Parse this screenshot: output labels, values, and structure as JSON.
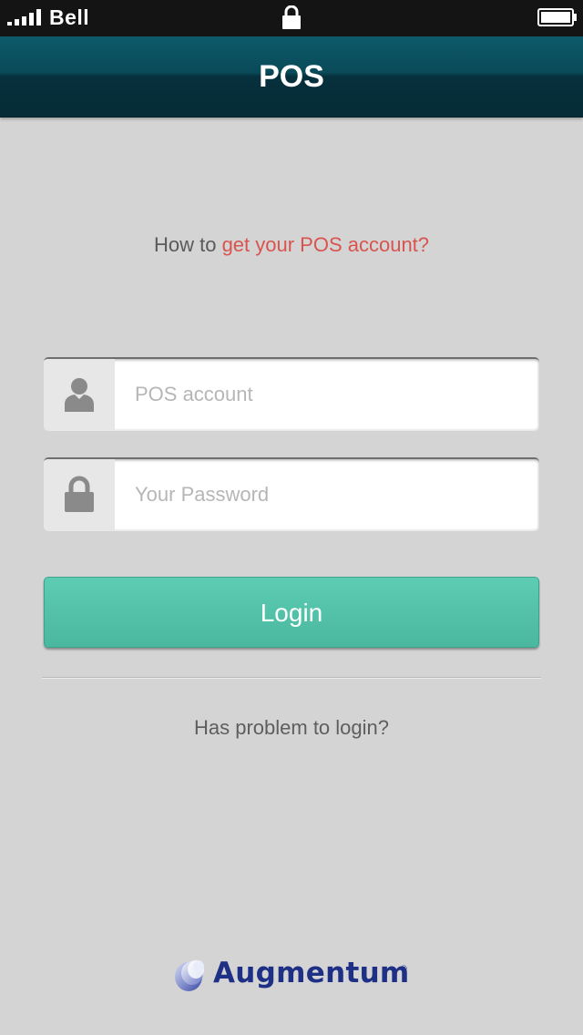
{
  "status_bar": {
    "carrier": "Bell",
    "signal_icon": "signal-bars-icon",
    "center_icon": "lock-icon",
    "battery_icon": "battery-icon"
  },
  "nav": {
    "title": "POS"
  },
  "help": {
    "prefix": "How to ",
    "link": "get your POS account?"
  },
  "form": {
    "account": {
      "placeholder": "POS account",
      "value": "",
      "icon": "user-icon"
    },
    "password": {
      "placeholder": "Your Password",
      "value": "",
      "icon": "lock-icon"
    },
    "login_label": "Login"
  },
  "problem_link": "Has problem to login?",
  "logo": {
    "text": "Augmentum",
    "registered": "®",
    "icon": "augmentum-logo-icon"
  },
  "colors": {
    "nav_bg": "#0a4a59",
    "accent_link": "#d9534f",
    "login_button": "#52c2a9",
    "page_bg": "#d4d4d4",
    "logo_blue": "#1e2f86"
  }
}
